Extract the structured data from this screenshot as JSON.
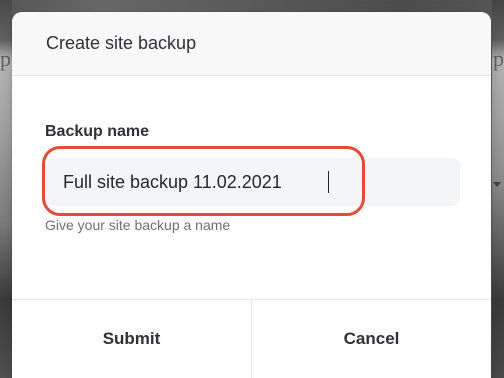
{
  "dialog": {
    "title": "Create site backup"
  },
  "field": {
    "label": "Backup name",
    "value": "Full site backup 11.02.2021",
    "help_text": "Give your site backup a name"
  },
  "buttons": {
    "submit": "Submit",
    "cancel": "Cancel"
  },
  "background": {
    "left_glyph": "p",
    "right_glyph": "p"
  },
  "colors": {
    "highlight": "#e14c38"
  }
}
